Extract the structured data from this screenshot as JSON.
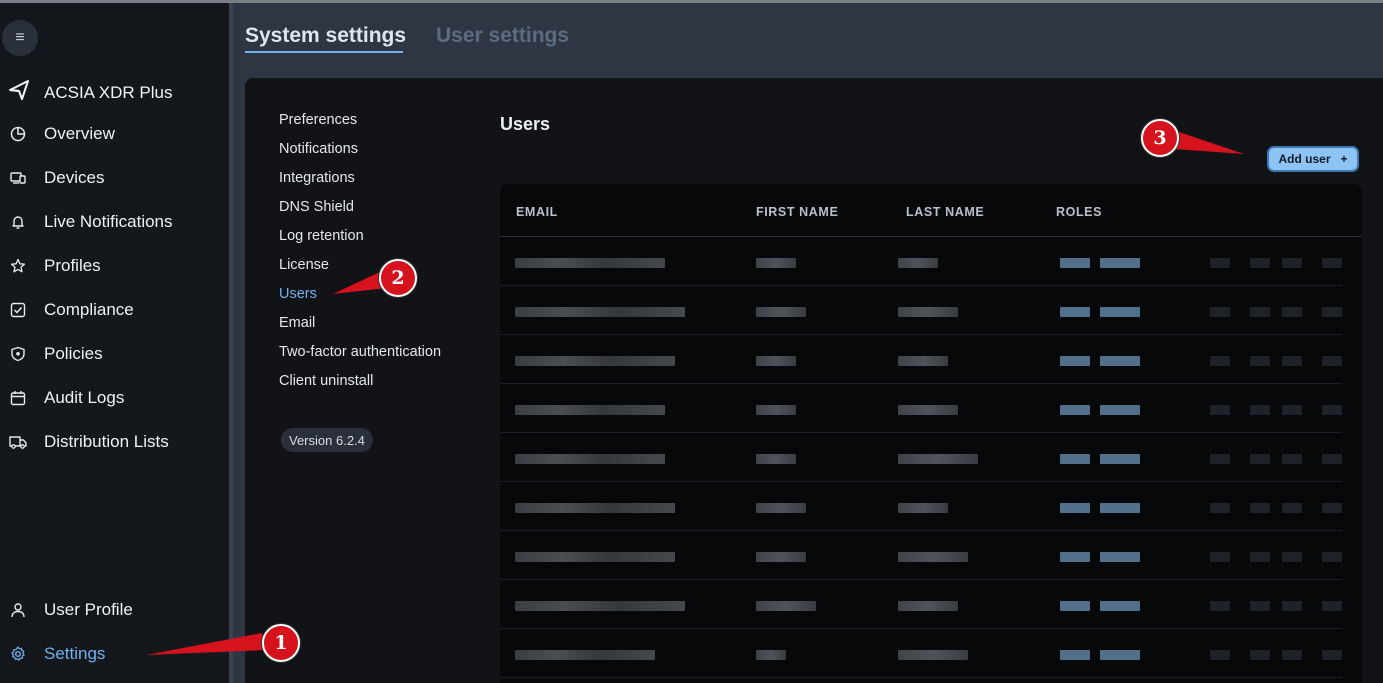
{
  "sidebar": {
    "brand": "ACSIA XDR Plus",
    "items": [
      {
        "label": "Overview",
        "icon": "pie-chart-icon"
      },
      {
        "label": "Devices",
        "icon": "devices-icon"
      },
      {
        "label": "Live Notifications",
        "icon": "bell-icon"
      },
      {
        "label": "Profiles",
        "icon": "star-icon"
      },
      {
        "label": "Compliance",
        "icon": "check-square-icon"
      },
      {
        "label": "Policies",
        "icon": "shield-icon"
      },
      {
        "label": "Audit Logs",
        "icon": "calendar-icon"
      },
      {
        "label": "Distribution Lists",
        "icon": "truck-icon"
      }
    ],
    "bottom": [
      {
        "label": "User Profile",
        "icon": "user-icon"
      },
      {
        "label": "Settings",
        "icon": "gear-icon",
        "active": true
      }
    ]
  },
  "tabs": {
    "active": "System settings",
    "inactive": "User settings"
  },
  "settings_menu": {
    "items": [
      "Preferences",
      "Notifications",
      "Integrations",
      "DNS Shield",
      "Log retention",
      "License",
      "Users",
      "Email",
      "Two-factor authentication",
      "Client uninstall"
    ],
    "active": "Users",
    "version": "Version 6.2.4"
  },
  "users": {
    "title": "Users",
    "add_button": "Add user",
    "add_icon": "+",
    "columns": [
      "EMAIL",
      "FIRST NAME",
      "LAST NAME",
      "ROLES"
    ],
    "row_count": 9,
    "rows_redacted": true
  },
  "annotations": {
    "markers": [
      "1",
      "2",
      "3"
    ],
    "color": "#d6131d"
  },
  "colors": {
    "accent": "#6fb2ee",
    "sidebar_bg": "#14171c",
    "panel_bg": "#111317",
    "button_bg": "#8ec4f3"
  }
}
